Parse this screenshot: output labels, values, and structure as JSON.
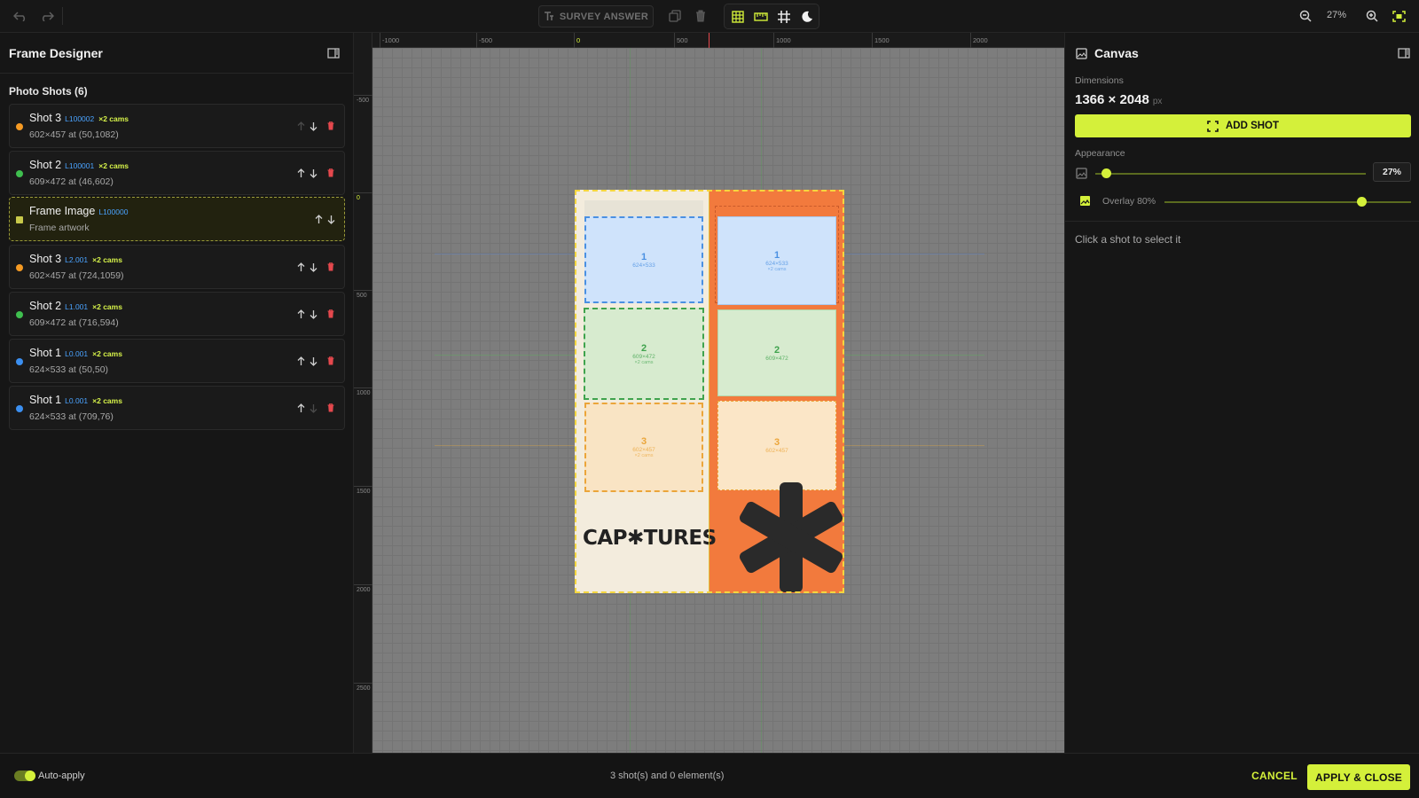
{
  "toolbar": {
    "survey_label": "SURVEY ANSWER",
    "zoom": "27%"
  },
  "left_panel": {
    "title": "Frame Designer",
    "section_title": "Photo Shots (6)",
    "items": [
      {
        "name": "Shot 3",
        "tag": "L100002",
        "cams": "×2 cams",
        "sub": "602×457 at (50,1082)",
        "color": "#f59a23",
        "kind": "dot",
        "delete": true
      },
      {
        "name": "Shot 2",
        "tag": "L100001",
        "cams": "×2 cams",
        "sub": "609×472 at (46,602)",
        "color": "#3fbf4f",
        "kind": "dot",
        "delete": true
      },
      {
        "name": "Frame Image",
        "tag": "L100000",
        "cams": "",
        "sub": "Frame artwork",
        "color": "#c8c94a",
        "kind": "square",
        "delete": false
      },
      {
        "name": "Shot 3",
        "tag": "L2.001",
        "cams": "×2 cams",
        "sub": "602×457 at (724,1059)",
        "color": "#f59a23",
        "kind": "dot",
        "delete": true
      },
      {
        "name": "Shot 2",
        "tag": "L1.001",
        "cams": "×2 cams",
        "sub": "609×472 at (716,594)",
        "color": "#3fbf4f",
        "kind": "dot",
        "delete": true
      },
      {
        "name": "Shot 1",
        "tag": "L0.001",
        "cams": "×2 cams",
        "sub": "624×533 at (50,50)",
        "color": "#3b8ff0",
        "kind": "dot",
        "delete": true
      },
      {
        "name": "Shot 1",
        "tag": "L0.001",
        "cams": "×2 cams",
        "sub": "624×533 at (709,76)",
        "color": "#3b8ff0",
        "kind": "dot",
        "delete": true
      }
    ]
  },
  "rulers": {
    "top": [
      "-1000",
      "-500",
      "0",
      "500",
      "1000",
      "1500",
      "2000"
    ],
    "left": [
      "-500",
      "0",
      "500",
      "1000",
      "1500",
      "2000",
      "2500"
    ]
  },
  "canvas": {
    "brand": "CAP✱TURES",
    "slots": [
      {
        "num": "1",
        "dim": "624×533",
        "cams": ""
      },
      {
        "num": "2",
        "dim": "609×472",
        "cams": "×2 cams"
      },
      {
        "num": "3",
        "dim": "602×457",
        "cams": "×2 cams"
      },
      {
        "num": "1",
        "dim": "624×533",
        "cams": "×2 cams"
      },
      {
        "num": "2",
        "dim": "609×472",
        "cams": ""
      },
      {
        "num": "3",
        "dim": "602×457",
        "cams": ""
      }
    ]
  },
  "right_panel": {
    "title": "Canvas",
    "dimensions_label": "Dimensions",
    "dimensions_value": "1366 × 2048",
    "dimensions_unit": "px",
    "add_shot_label": "ADD SHOT",
    "appearance_label": "Appearance",
    "zoom_pct": "27%",
    "overlay_label": "Overlay 80%",
    "hint": "Click a shot to select it"
  },
  "bottom": {
    "auto_apply_label": "Auto-apply",
    "status": "3 shot(s) and 0 element(s)",
    "cancel_label": "CANCEL",
    "apply_label": "APPLY & CLOSE"
  }
}
